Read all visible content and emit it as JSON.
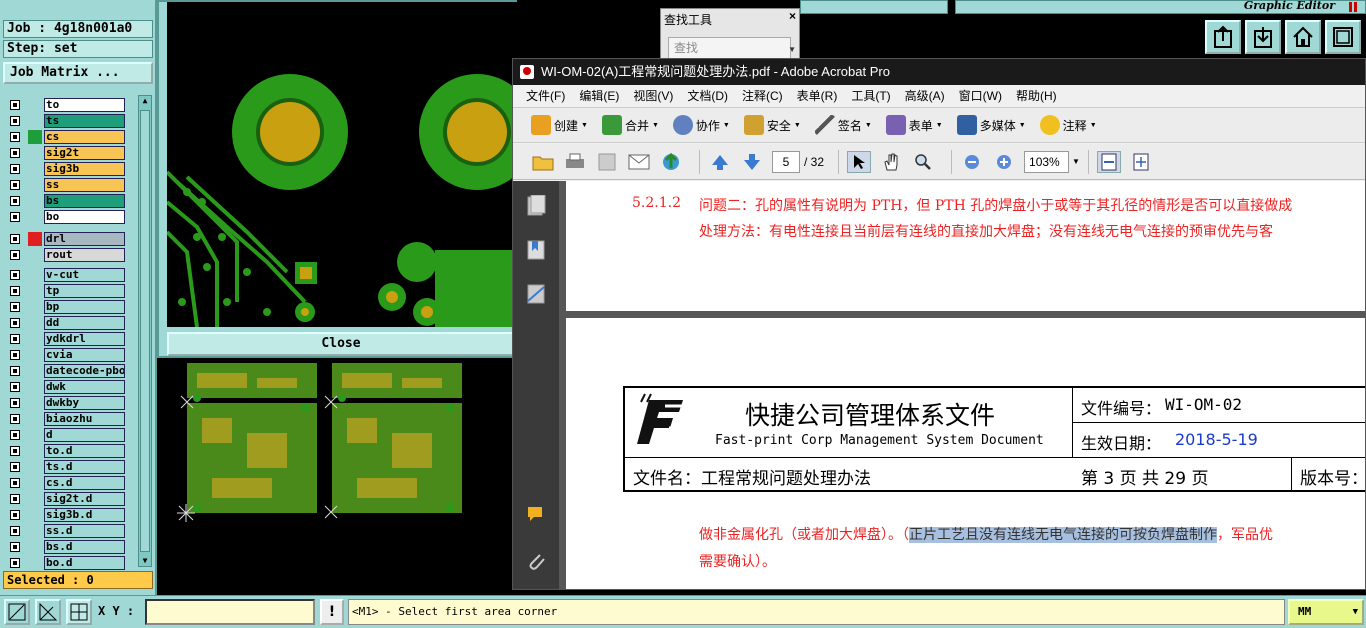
{
  "genesis": {
    "job_field": "Job : 4g18n001a0",
    "step_field": "Step: set",
    "job_matrix_button": "Job Matrix ...",
    "layers": [
      {
        "name": "to",
        "color": "#ffffff",
        "swatch": ""
      },
      {
        "name": "ts",
        "color": "#1e9e7a",
        "swatch": ""
      },
      {
        "name": "cs",
        "color": "#f7c455",
        "swatch": "#1e9e3a"
      },
      {
        "name": "sig2t",
        "color": "#f7c455",
        "swatch": ""
      },
      {
        "name": "sig3b",
        "color": "#f7c455",
        "swatch": ""
      },
      {
        "name": "ss",
        "color": "#f7c455",
        "swatch": ""
      },
      {
        "name": "bs",
        "color": "#1e9e7a",
        "swatch": ""
      },
      {
        "name": "bo",
        "color": "#ffffff",
        "swatch": ""
      },
      {
        "name": "drl",
        "color": "#a8b8c0",
        "swatch": "#e02020"
      },
      {
        "name": "rout",
        "color": "#d8d8d8",
        "swatch": ""
      },
      {
        "name": "v-cut",
        "color": "#9fd8d4",
        "swatch": ""
      },
      {
        "name": "tp",
        "color": "#9fd8d4",
        "swatch": ""
      },
      {
        "name": "bp",
        "color": "#9fd8d4",
        "swatch": ""
      },
      {
        "name": "dd",
        "color": "#9fd8d4",
        "swatch": ""
      },
      {
        "name": "ydkdrl",
        "color": "#9fd8d4",
        "swatch": ""
      },
      {
        "name": "cvia",
        "color": "#9fd8d4",
        "swatch": ""
      },
      {
        "name": "datecode-pbo",
        "color": "#9fd8d4",
        "swatch": ""
      },
      {
        "name": "dwk",
        "color": "#9fd8d4",
        "swatch": ""
      },
      {
        "name": "dwkby",
        "color": "#9fd8d4",
        "swatch": ""
      },
      {
        "name": "biaozhu",
        "color": "#9fd8d4",
        "swatch": ""
      },
      {
        "name": "d",
        "color": "#9fd8d4",
        "swatch": ""
      },
      {
        "name": "to.d",
        "color": "#9fd8d4",
        "swatch": ""
      },
      {
        "name": "ts.d",
        "color": "#9fd8d4",
        "swatch": ""
      },
      {
        "name": "cs.d",
        "color": "#9fd8d4",
        "swatch": ""
      },
      {
        "name": "sig2t.d",
        "color": "#9fd8d4",
        "swatch": ""
      },
      {
        "name": "sig3b.d",
        "color": "#9fd8d4",
        "swatch": ""
      },
      {
        "name": "ss.d",
        "color": "#9fd8d4",
        "swatch": ""
      },
      {
        "name": "bs.d",
        "color": "#9fd8d4",
        "swatch": ""
      },
      {
        "name": "bo.d",
        "color": "#9fd8d4",
        "swatch": ""
      }
    ],
    "selected": "Selected : 0",
    "close_button": "Close",
    "graphic_editor_title": "Graphic Editor",
    "xy_label": "X Y :",
    "status_message": "<M1> - Select first area corner",
    "units": "MM",
    "warn_label": "!"
  },
  "find_tool": {
    "title": "查找工具",
    "close": "×",
    "placeholder": "查找"
  },
  "acrobat": {
    "title": "WI-OM-02(A)工程常规问题处理办法.pdf - Adobe Acrobat Pro",
    "menu": [
      "文件(F)",
      "编辑(E)",
      "视图(V)",
      "文档(D)",
      "注释(C)",
      "表单(R)",
      "工具(T)",
      "高级(A)",
      "窗口(W)",
      "帮助(H)"
    ],
    "toolbar": [
      "创建",
      "合并",
      "协作",
      "安全",
      "签名",
      "表单",
      "多媒体",
      "注释"
    ],
    "page_current": "5",
    "page_total": "/ 32",
    "zoom": "103%",
    "page1": {
      "line1_num": "5.2.1.2",
      "line1": "问题二：孔的属性有说明为 PTH，但 PTH 孔的焊盘小于或等于其孔径的情形是否可以直接做成",
      "line2": "处理方法：有电性连接且当前层有连线的直接加大焊盘；没有连线无电气连接的预审优先与客"
    },
    "page2": {
      "company_cn": "快捷公司管理体系文件",
      "company_en": "Fast-print Corp Management System Document",
      "doc_no_label": "文件编号：",
      "doc_no": "WI-OM-02",
      "eff_date_label": "生效日期：",
      "eff_date": "2018-5-19",
      "file_name": "文件名：工程常规问题处理办法",
      "page_info": "第 3 页 共 29 页",
      "version_label": "版本号：",
      "body1_pre": "做非金属化孔（或者加大焊盘）。（",
      "body1_hl": "正片工艺且没有连线无电气连接的可按负焊盘制作",
      "body1_post": "，军品优",
      "body2": "需要确认）。"
    }
  }
}
